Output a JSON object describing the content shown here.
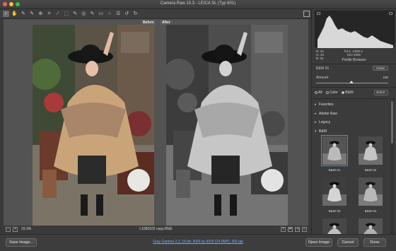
{
  "window": {
    "title": "Camera Raw 10.3  -  LEICA SL (Typ 601)"
  },
  "toolbar": {
    "tools": [
      {
        "name": "zoom-tool",
        "glyph": "⌕"
      },
      {
        "name": "hand-tool",
        "glyph": "✋"
      },
      {
        "name": "white-balance-tool",
        "glyph": "✎"
      },
      {
        "name": "color-sampler-tool",
        "glyph": "✎"
      },
      {
        "name": "targeted-adjustment-tool",
        "glyph": "⊕"
      },
      {
        "name": "crop-tool",
        "glyph": "⌗"
      },
      {
        "name": "straighten-tool",
        "glyph": "⟋"
      },
      {
        "name": "transform-tool",
        "glyph": "⬚"
      },
      {
        "name": "spot-removal-tool",
        "glyph": "✎"
      },
      {
        "name": "red-eye-tool",
        "glyph": "◎"
      },
      {
        "name": "adjustment-brush-tool",
        "glyph": "✎"
      },
      {
        "name": "graduated-filter-tool",
        "glyph": "▭"
      },
      {
        "name": "radial-filter-tool",
        "glyph": "○"
      },
      {
        "name": "preferences-tool",
        "glyph": "☰"
      },
      {
        "name": "rotate-ccw-tool",
        "glyph": "↺"
      },
      {
        "name": "rotate-cw-tool",
        "glyph": "↻"
      }
    ]
  },
  "viewer": {
    "before_label": "Before",
    "after_label": "After",
    "zoom": "23.3%",
    "filename": "L1050102 copy.DNG"
  },
  "panel": {
    "rgb": {
      "r_label": "R:",
      "g_label": "G:",
      "b_label": "B:",
      "r": "34",
      "g": "34",
      "b": "34"
    },
    "exposure": {
      "aperture": "f/3.5",
      "shutter": "1/500 s",
      "iso": "ISO 2000"
    },
    "profile_browser": "Profile Browser",
    "profile_name": "B&W 01",
    "close_label": "Close",
    "amount_label": "Amount",
    "amount_value": "100",
    "amount_fraction": 0.5,
    "filters": {
      "all": "All",
      "color": "Color",
      "bw": "B&W",
      "view": "Grid"
    },
    "sections": [
      {
        "label": "Favorites",
        "open": false
      },
      {
        "label": "Adobe Raw",
        "open": false
      },
      {
        "label": "Legacy",
        "open": false
      },
      {
        "label": "B&W",
        "open": true
      }
    ],
    "thumbs": [
      "B&W 01",
      "B&W 02",
      "B&W 03",
      "B&W 04"
    ]
  },
  "bottom": {
    "save_label": "Save Image...",
    "workflow": "Gray Gamma 2.2; 16 bit; 4000 by 6000 (24.0MP); 300 ppi",
    "open_label": "Open Image",
    "cancel_label": "Cancel",
    "done_label": "Done"
  },
  "colors": {
    "accent": "#4d8fd6",
    "link": "#6fb0ff"
  }
}
